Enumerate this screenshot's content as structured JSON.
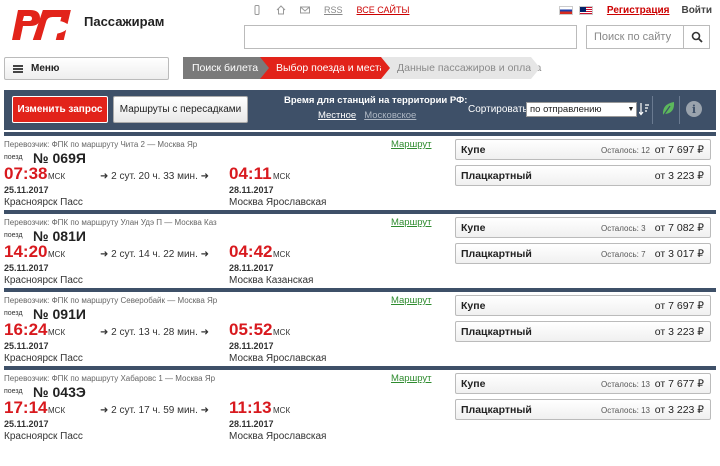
{
  "header": {
    "brand": "Пассажирам",
    "links": {
      "rss": "RSS",
      "all_sites": "ВСЕ САЙТЫ"
    },
    "register": "Регистрация",
    "login": "Войти",
    "site_search_placeholder": "Поиск по сайту"
  },
  "menu": {
    "label": "Меню"
  },
  "steps": [
    "Поиск билета",
    "Выбор поезда и места",
    "Данные пассажиров и оплата"
  ],
  "toolbar": {
    "change_request": "Изменить запрос",
    "transfer_routes": "Маршруты с пересадками",
    "timezone_label": "Время для станций на территории РФ:",
    "tz_local": "Местное",
    "tz_moscow": "Московское",
    "sort_label": "Сортировать",
    "sort_value": "по отправлению"
  },
  "route_link_label": "Маршрут",
  "train_word": "поезд",
  "msk": "МСК",
  "trains": [
    {
      "carrier": "Перевозчик: ФПК   по маршруту Чита 2 — Москва Яр",
      "number": "№ 069Я",
      "dep_time": "07:38",
      "dep_date": "25.11.2017",
      "dep_station": "Красноярск Пасс",
      "duration": "➜ 2 сут. 20 ч. 33 мин. ➜",
      "arr_time": "04:11",
      "arr_date": "28.11.2017",
      "arr_station": "Москва Ярославская",
      "fares": [
        {
          "class": "Купе",
          "seats": "Осталось: 12",
          "price": "от 7 697 ₽"
        },
        {
          "class": "Плацкартный",
          "seats": "",
          "price": "от 3 223 ₽"
        }
      ]
    },
    {
      "carrier": "Перевозчик: ФПК   по маршруту Улан Удэ П — Москва Каз",
      "number": "№ 081И",
      "dep_time": "14:20",
      "dep_date": "25.11.2017",
      "dep_station": "Красноярск Пасс",
      "duration": "➜ 2 сут. 14 ч. 22 мин. ➜",
      "arr_time": "04:42",
      "arr_date": "28.11.2017",
      "arr_station": "Москва Казанская",
      "fares": [
        {
          "class": "Купе",
          "seats": "Осталось: 3",
          "price": "от 7 082 ₽"
        },
        {
          "class": "Плацкартный",
          "seats": "Осталось: 7",
          "price": "от 3 017 ₽"
        }
      ]
    },
    {
      "carrier": "Перевозчик: ФПК   по маршруту Северобайк — Москва Яр",
      "number": "№ 091И",
      "dep_time": "16:24",
      "dep_date": "25.11.2017",
      "dep_station": "Красноярск Пасс",
      "duration": "➜ 2 сут. 13 ч. 28 мин. ➜",
      "arr_time": "05:52",
      "arr_date": "28.11.2017",
      "arr_station": "Москва Ярославская",
      "fares": [
        {
          "class": "Купе",
          "seats": "",
          "price": "от 7 697 ₽"
        },
        {
          "class": "Плацкартный",
          "seats": "",
          "price": "от 3 223 ₽"
        }
      ]
    },
    {
      "carrier": "Перевозчик: ФПК   по маршруту Хабаровс 1 — Москва Яр",
      "number": "№ 043Э",
      "dep_time": "17:14",
      "dep_date": "25.11.2017",
      "dep_station": "Красноярск Пасс",
      "duration": "➜ 2 сут. 17 ч. 59 мин. ➜",
      "arr_time": "11:13",
      "arr_date": "28.11.2017",
      "arr_station": "Москва Ярославская",
      "fares": [
        {
          "class": "Купе",
          "seats": "Осталось: 13",
          "price": "от 7 677 ₽"
        },
        {
          "class": "Плацкартный",
          "seats": "Осталось: 13",
          "price": "от 3 223 ₽"
        }
      ]
    }
  ],
  "colors": {
    "brand_red": "#e2231a",
    "toolbar_blue": "#3e5068",
    "route_green": "#2e8b2e"
  },
  "icons": [
    "rzd-logo",
    "phone-icon",
    "home-icon",
    "mail-icon",
    "search-icon",
    "menu-icon",
    "sort-icon",
    "leaf-icon",
    "info-icon"
  ]
}
